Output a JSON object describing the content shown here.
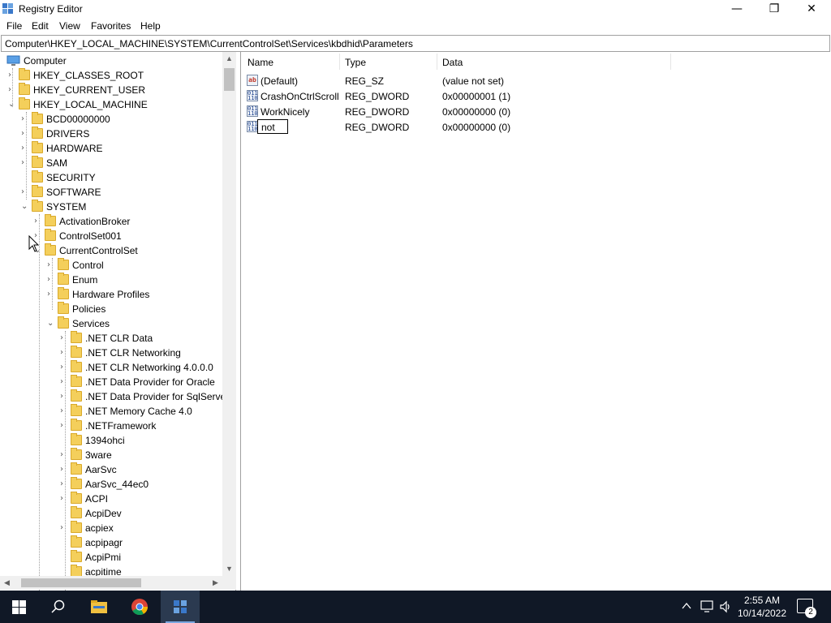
{
  "window": {
    "title": "Registry Editor",
    "minimize": "—",
    "maximize": "❐",
    "close": "✕"
  },
  "menu": {
    "file": "File",
    "edit": "Edit",
    "view": "View",
    "favorites": "Favorites",
    "help": "Help"
  },
  "address": "Computer\\HKEY_LOCAL_MACHINE\\SYSTEM\\CurrentControlSet\\Services\\kbdhid\\Parameters",
  "tree": {
    "computer": "Computer",
    "hkcr": "HKEY_CLASSES_ROOT",
    "hkcu": "HKEY_CURRENT_USER",
    "hklm": "HKEY_LOCAL_MACHINE",
    "bcd": "BCD00000000",
    "drivers": "DRIVERS",
    "hardware": "HARDWARE",
    "sam": "SAM",
    "security": "SECURITY",
    "software": "SOFTWARE",
    "system": "SYSTEM",
    "activationbroker": "ActivationBroker",
    "controlset001": "ControlSet001",
    "currentcontrolset": "CurrentControlSet",
    "control": "Control",
    "enum": "Enum",
    "hardwareprofiles": "Hardware Profiles",
    "policies": "Policies",
    "services": "Services",
    "s1": ".NET CLR Data",
    "s2": ".NET CLR Networking",
    "s3": ".NET CLR Networking 4.0.0.0",
    "s4": ".NET Data Provider for Oracle",
    "s5": ".NET Data Provider for SqlServe",
    "s6": ".NET Memory Cache 4.0",
    "s7": ".NETFramework",
    "s8": "1394ohci",
    "s9": "3ware",
    "s10": "AarSvc",
    "s11": "AarSvc_44ec0",
    "s12": "ACPI",
    "s13": "AcpiDev",
    "s14": "acpiex",
    "s15": "acpipagr",
    "s16": "AcpiPmi",
    "s17": "acpitime"
  },
  "columns": {
    "name": "Name",
    "type": "Type",
    "data": "Data"
  },
  "values": [
    {
      "name": "(Default)",
      "type": "REG_SZ",
      "data": "(value not set)"
    },
    {
      "name": "CrashOnCtrlScroll",
      "type": "REG_DWORD",
      "data": "0x00000001 (1)"
    },
    {
      "name": "WorkNicely",
      "type": "REG_DWORD",
      "data": "0x00000000 (0)"
    },
    {
      "name": "not",
      "type": "REG_DWORD",
      "data": "0x00000000 (0)"
    }
  ],
  "taskbar": {
    "time": "2:55 AM",
    "date": "10/14/2022",
    "notifications": "2"
  }
}
